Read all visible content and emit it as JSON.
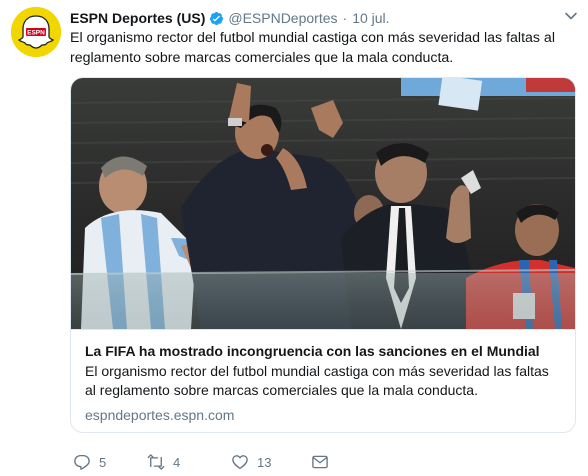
{
  "tweet": {
    "author_name": "ESPN Deportes (US)",
    "handle": "@ESPNDeportes",
    "separator": "·",
    "time": "10 jul.",
    "text": "El organismo rector del futbol mundial castiga con más severidad las faltas al reglamento sobre marcas comerciales que la mala conducta.",
    "avatar_text": "ESPN"
  },
  "card": {
    "title": "La FIFA ha mostrado incongruencia con las sanciones en el Mundial",
    "description": "El organismo rector del futbol mundial castiga con más severidad las faltas al reglamento sobre marcas comerciales que la mala conducta.",
    "domain": "espndeportes.espn.com"
  },
  "actions": {
    "replies": "5",
    "retweets": "4",
    "likes": "13"
  },
  "icons": {
    "reply": "reply-icon",
    "retweet": "retweet-icon",
    "like": "heart-icon",
    "dm": "envelope-icon",
    "verified": "verified-badge-icon",
    "caret": "chevron-down-icon"
  },
  "colors": {
    "text": "#14171a",
    "secondary": "#657786",
    "verified": "#1da1f2",
    "border": "#e1e8ed",
    "avatar_bg": "#f2d600"
  }
}
